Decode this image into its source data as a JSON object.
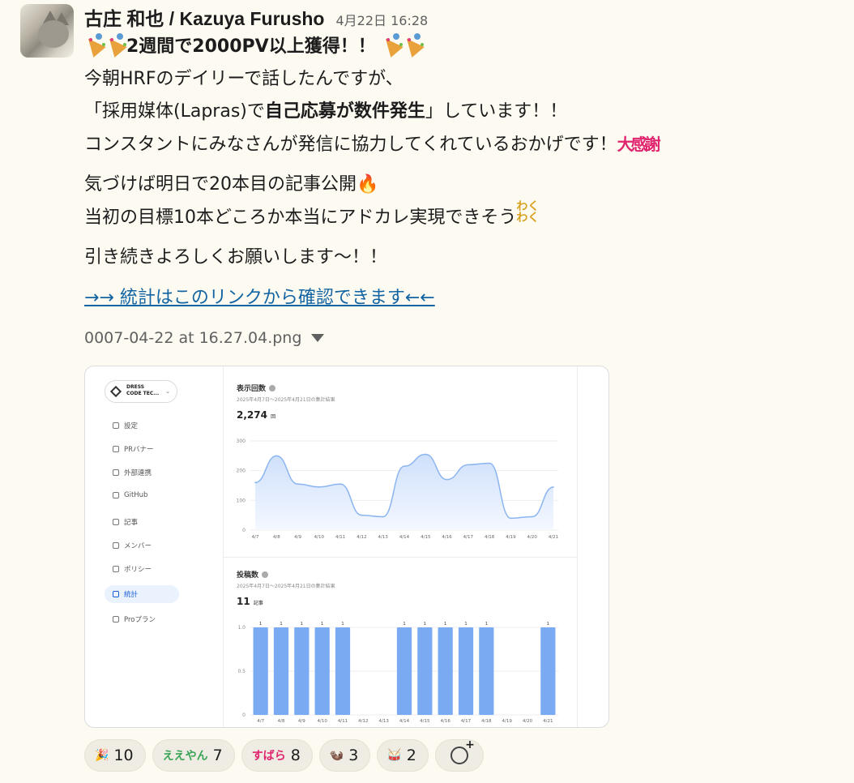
{
  "message": {
    "author": "古庄 和也 / Kazuya Furusho",
    "timestamp": "4月22日 16:28",
    "headline": "2週間で2000PV以上獲得！！",
    "line1": "今朝HRFのデイリーで話したんですが、",
    "line2_pre": "「採用媒体(Lapras)で",
    "line2_bold": "自己応募が数件発生",
    "line2_post": "」しています！！",
    "line3": "コンスタントにみなさんが発信に協力してくれているおかげです！",
    "daikansha": "大感謝",
    "line4": "気づけば明日で20本目の記事公開",
    "line5": "当初の目標10本どころか本当にアドカレ実現できそう",
    "wakuwaku": "わくわく",
    "line6": "引き続きよろしくお願いします〜！！",
    "link_text": "→→ 統計はこのリンクから確認できます←←"
  },
  "attachment": {
    "filename": "0007-04-22 at 16.27.04.png",
    "org_name_1": "DRESS",
    "org_name_2": "CODE TEC...",
    "nav": [
      {
        "label": "設定",
        "icon": "gear-icon"
      },
      {
        "label": "PRバナー",
        "icon": "image-icon"
      },
      {
        "label": "外部連携",
        "icon": "bolt-icon"
      },
      {
        "label": "GitHub",
        "icon": "github-icon"
      },
      {
        "label": "記事",
        "icon": "document-icon"
      },
      {
        "label": "メンバー",
        "icon": "users-icon"
      },
      {
        "label": "ポリシー",
        "icon": "copy-icon"
      },
      {
        "label": "統計",
        "icon": "chart-icon"
      },
      {
        "label": "Proプラン",
        "icon": "sparkle-icon"
      }
    ],
    "views_panel": {
      "title": "表示回数",
      "subtitle": "2025年4月7日〜2025年4月21日の集計結果",
      "total": "2,274",
      "unit": "回"
    },
    "posts_panel": {
      "title": "投稿数",
      "subtitle": "2025年4月7日〜2025年4月21日の集計結果",
      "total": "11",
      "unit": "記事"
    }
  },
  "chart_data": [
    {
      "type": "area",
      "title": "表示回数",
      "x": [
        "4/7",
        "4/8",
        "4/9",
        "4/10",
        "4/11",
        "4/12",
        "4/13",
        "4/14",
        "4/15",
        "4/16",
        "4/17",
        "4/18",
        "4/19",
        "4/20",
        "4/21"
      ],
      "values": [
        160,
        250,
        155,
        145,
        155,
        50,
        45,
        215,
        255,
        170,
        220,
        225,
        40,
        45,
        145
      ],
      "yticks": [
        0,
        100,
        200,
        300
      ],
      "ylim": [
        0,
        300
      ],
      "color": "#8bb5f0"
    },
    {
      "type": "bar",
      "title": "投稿数",
      "categories": [
        "4/7",
        "4/8",
        "4/9",
        "4/10",
        "4/11",
        "4/12",
        "4/13",
        "4/14",
        "4/15",
        "4/16",
        "4/17",
        "4/18",
        "4/19",
        "4/20",
        "4/21"
      ],
      "values": [
        1,
        1,
        1,
        1,
        1,
        0,
        0,
        1,
        1,
        1,
        1,
        1,
        0,
        0,
        1
      ],
      "yticks": [
        "0",
        "0.5",
        "1.0"
      ],
      "ylim": [
        0,
        1
      ],
      "color": "#7aaaf2"
    }
  ],
  "reactions": [
    {
      "emoji": "party-popper-icon",
      "label": "🎉",
      "count": "10"
    },
    {
      "emoji": "eeyan-icon",
      "label": "ええやん",
      "count": "7"
    },
    {
      "emoji": "subara-icon",
      "label": "すばら",
      "count": "8"
    },
    {
      "emoji": "otter-icon",
      "label": "🦦",
      "count": "3"
    },
    {
      "emoji": "drummer-icon",
      "label": "🥁",
      "count": "2"
    }
  ]
}
